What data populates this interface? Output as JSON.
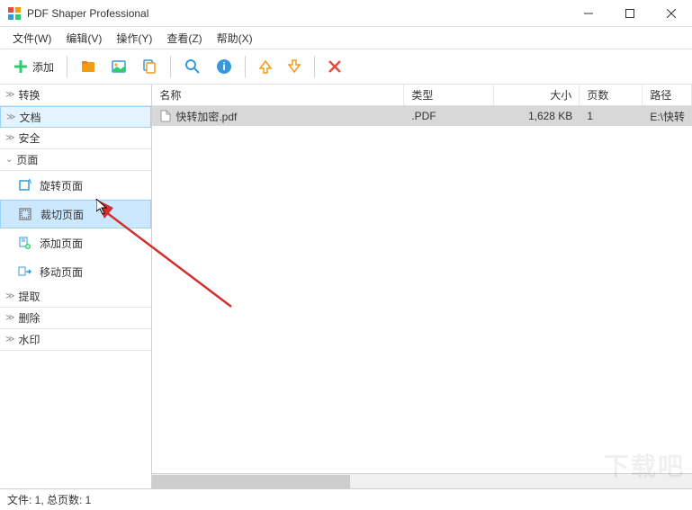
{
  "window": {
    "title": "PDF Shaper Professional"
  },
  "menu": {
    "file": "文件(W)",
    "edit": "编辑(V)",
    "action": "操作(Y)",
    "view": "查看(Z)",
    "help": "帮助(X)"
  },
  "toolbar": {
    "add_label": "添加"
  },
  "sidebar": {
    "convert": "转换",
    "document": "文档",
    "security": "安全",
    "page": "页面",
    "rotate_pages": "旋转页面",
    "crop_pages": "裁切页面",
    "add_pages": "添加页面",
    "move_pages": "移动页面",
    "extract": "提取",
    "delete": "删除",
    "watermark": "水印"
  },
  "list": {
    "headers": {
      "name": "名称",
      "type": "类型",
      "size": "大小",
      "pages": "页数",
      "path": "路径"
    },
    "rows": [
      {
        "name": "快转加密.pdf",
        "type": ".PDF",
        "size": "1,628 KB",
        "pages": "1",
        "path": "E:\\快转"
      }
    ]
  },
  "statusbar": {
    "text": "文件: 1, 总页数: 1"
  },
  "watermark": "下载吧"
}
